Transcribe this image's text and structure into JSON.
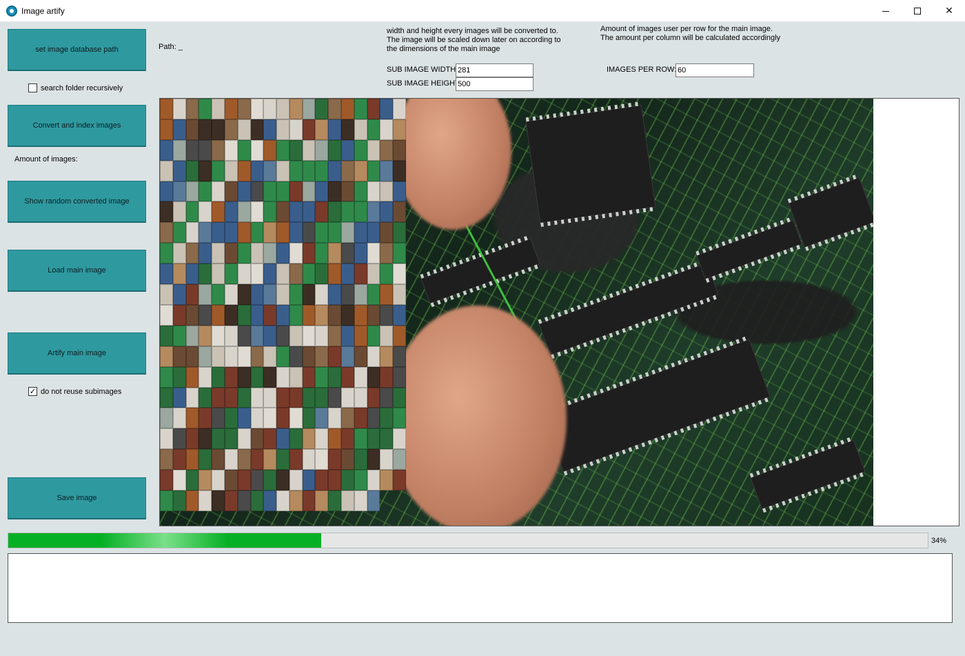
{
  "window": {
    "title": "Image artify",
    "icon": "app-logo-icon"
  },
  "controls": {
    "set_db_path": "set image database path",
    "search_recursive": {
      "label": "search folder recursively",
      "checked": false
    },
    "convert_index": "Convert and index images",
    "amount_label": "Amount of images:",
    "show_random": "Show random converted image",
    "load_main": "Load main image",
    "artify": "Artify main image",
    "no_reuse": {
      "label": "do not reuse subimages",
      "checked": true
    },
    "save": "Save image"
  },
  "path": {
    "label": "Path: _"
  },
  "size_help": "width and height every images will be converted to. The image will be scaled down later on according to the dimensions of the main image",
  "per_row_help": "Amount of images user per row for the main image. The amount per column will be calculated accordingly",
  "fields": {
    "width_label": "SUB IMAGE WIDTH:",
    "width_value": "281",
    "height_label": "SUB IMAGE HEIGHT:",
    "height_value": "500",
    "per_row_label": "IMAGES PER ROW:",
    "per_row_value": "60"
  },
  "progress": {
    "value": 0.34,
    "text": "34%"
  },
  "colors": {
    "button": "#2f99a0",
    "progress": "#06b025"
  }
}
